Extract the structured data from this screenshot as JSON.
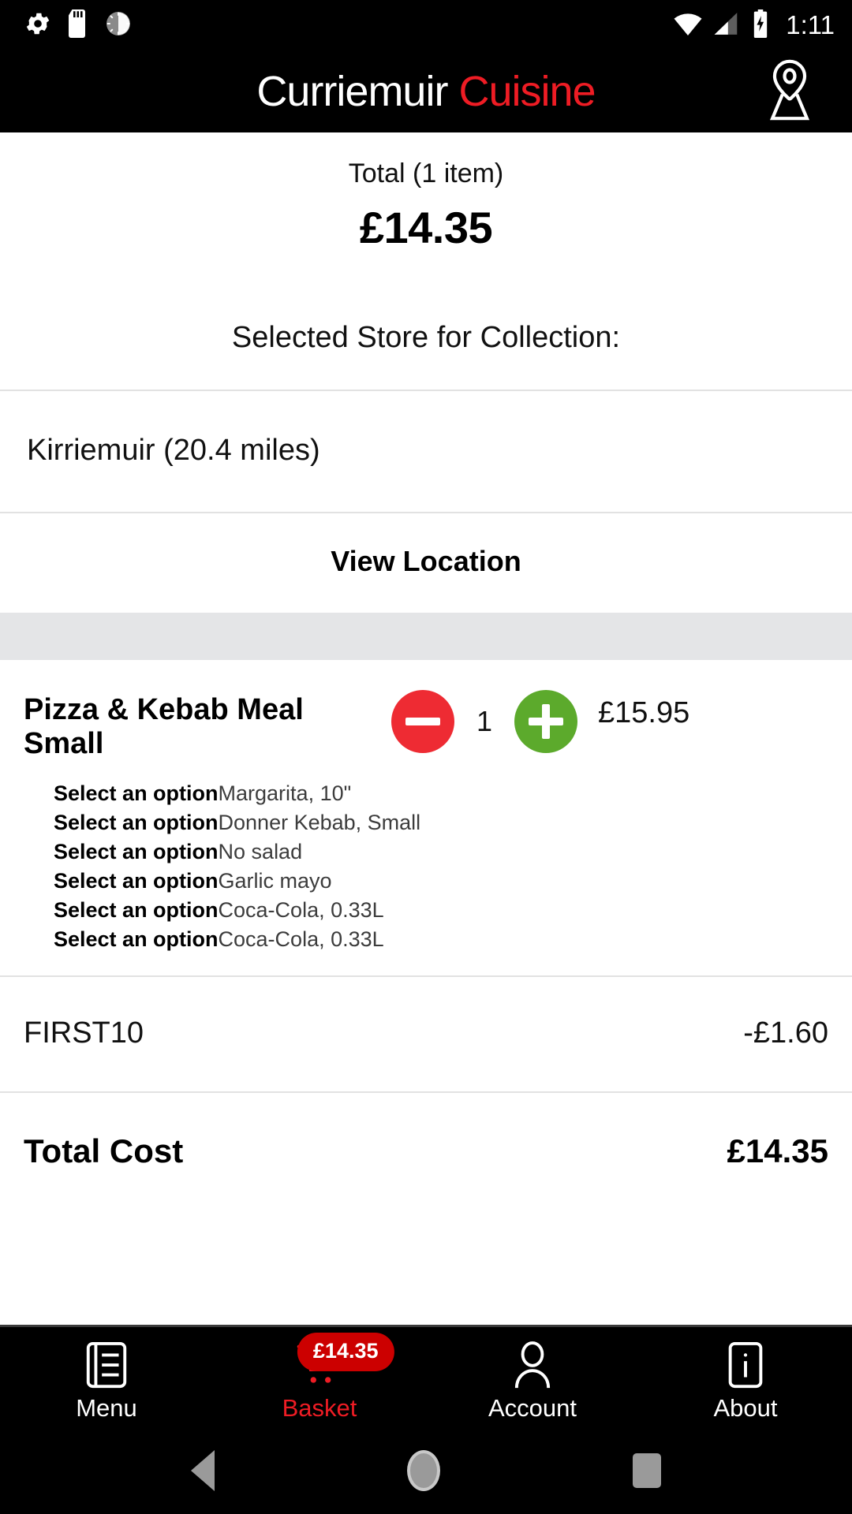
{
  "status_bar": {
    "icons_left": [
      "gear-icon",
      "sd-card-icon",
      "sync-progress-icon"
    ],
    "icons_right": [
      "wifi-icon",
      "cellular-signal-icon",
      "battery-charging-icon"
    ],
    "time": "1:11"
  },
  "app_bar": {
    "brand_first": "Curriemuir",
    "brand_second": "Cuisine",
    "brand_first_color": "#ffffff",
    "brand_second_color": "#ee1c24",
    "location_icon": "map-pin-icon"
  },
  "summary": {
    "total_label": "Total (1 item)",
    "total_amount": "£14.35",
    "collection_label": "Selected Store for Collection:"
  },
  "store": {
    "name_and_distance": "Kirriemuir (20.4 miles)",
    "view_location_label": "View Location"
  },
  "basket_item": {
    "name": "Pizza & Kebab Meal Small",
    "decrease_label": "−",
    "quantity": "1",
    "increase_label": "+",
    "price": "£15.95",
    "options": [
      {
        "label": "Select an option",
        "value": "Margarita, 10\""
      },
      {
        "label": "Select an option",
        "value": "Donner Kebab, Small"
      },
      {
        "label": "Select an option",
        "value": "No salad"
      },
      {
        "label": "Select an option",
        "value": "Garlic mayo"
      },
      {
        "label": "Select an option",
        "value": "Coca-Cola, 0.33L"
      },
      {
        "label": "Select an option",
        "value": "Coca-Cola, 0.33L"
      }
    ]
  },
  "discount": {
    "code": "FIRST10",
    "amount": "-£1.60"
  },
  "total_cost": {
    "label": "Total Cost",
    "amount": "£14.35"
  },
  "bottom_nav": {
    "items": [
      {
        "label": "Menu",
        "icon": "menu-list-icon"
      },
      {
        "label": "Basket",
        "icon": "shopping-cart-icon",
        "badge": "£14.35"
      },
      {
        "label": "Account",
        "icon": "person-icon"
      },
      {
        "label": "About",
        "icon": "info-icon"
      }
    ],
    "active_color": "#ee1c24",
    "badge_color": "#cc0000"
  },
  "android_nav": {
    "back": "back-triangle-icon",
    "home": "home-circle-icon",
    "recents": "recents-square-icon"
  }
}
